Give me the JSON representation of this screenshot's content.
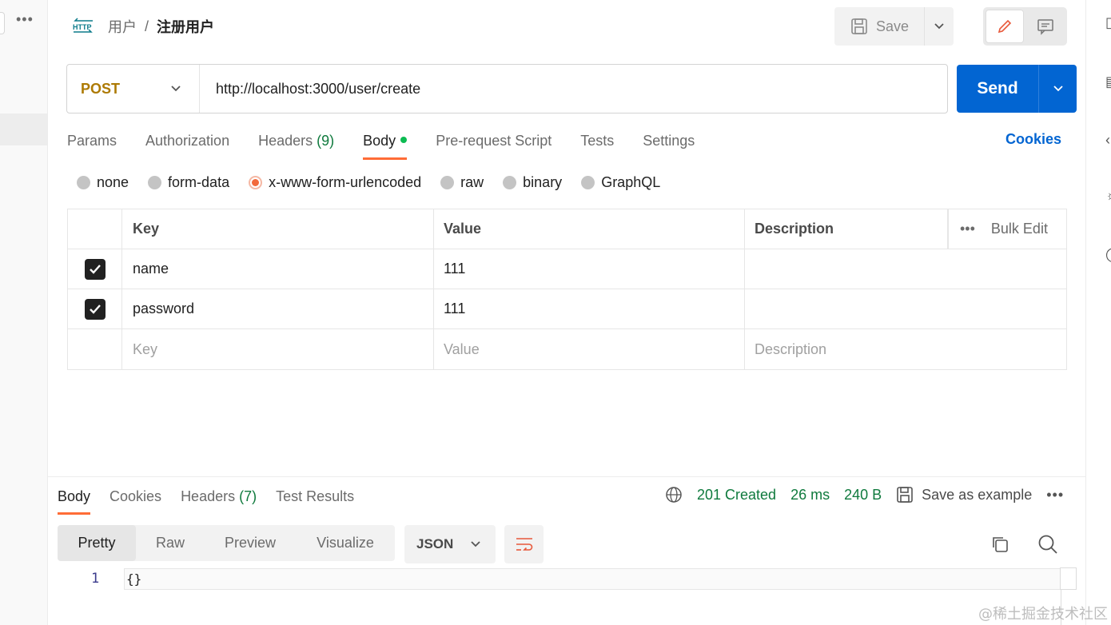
{
  "breadcrumb": {
    "parent": "用户",
    "separator": "/",
    "current": "注册用户"
  },
  "header": {
    "save_label": "Save"
  },
  "request": {
    "method": "POST",
    "url": "http://localhost:3000/user/create",
    "send_label": "Send"
  },
  "request_tabs": [
    {
      "label": "Params"
    },
    {
      "label": "Authorization"
    },
    {
      "label": "Headers",
      "count": "(9)"
    },
    {
      "label": "Body"
    },
    {
      "label": "Pre-request Script"
    },
    {
      "label": "Tests"
    },
    {
      "label": "Settings"
    }
  ],
  "cookies_label": "Cookies",
  "body_types": [
    "none",
    "form-data",
    "x-www-form-urlencoded",
    "raw",
    "binary",
    "GraphQL"
  ],
  "body_type_selected": "x-www-form-urlencoded",
  "table": {
    "headers": {
      "key": "Key",
      "value": "Value",
      "description": "Description",
      "bulk_edit": "Bulk Edit"
    },
    "rows": [
      {
        "checked": true,
        "key": "name",
        "value": "111",
        "description": ""
      },
      {
        "checked": true,
        "key": "password",
        "value": "111",
        "description": ""
      }
    ],
    "placeholders": {
      "key": "Key",
      "value": "Value",
      "description": "Description"
    }
  },
  "response": {
    "tabs": [
      {
        "label": "Body"
      },
      {
        "label": "Cookies"
      },
      {
        "label": "Headers",
        "count": "(7)"
      },
      {
        "label": "Test Results"
      }
    ],
    "status": "201 Created",
    "time": "26 ms",
    "size": "240 B",
    "save_example_label": "Save as example",
    "view_modes": [
      "Pretty",
      "Raw",
      "Preview",
      "Visualize"
    ],
    "format": "JSON",
    "code_lines": [
      {
        "number": "1",
        "text": "{}"
      }
    ]
  },
  "watermark": "@稀土掘金技术社区",
  "colors": {
    "accent_orange": "#ff6c37",
    "send_blue": "#0265d2",
    "method_post": "#ad7a03",
    "status_green": "#0f7a3d"
  }
}
